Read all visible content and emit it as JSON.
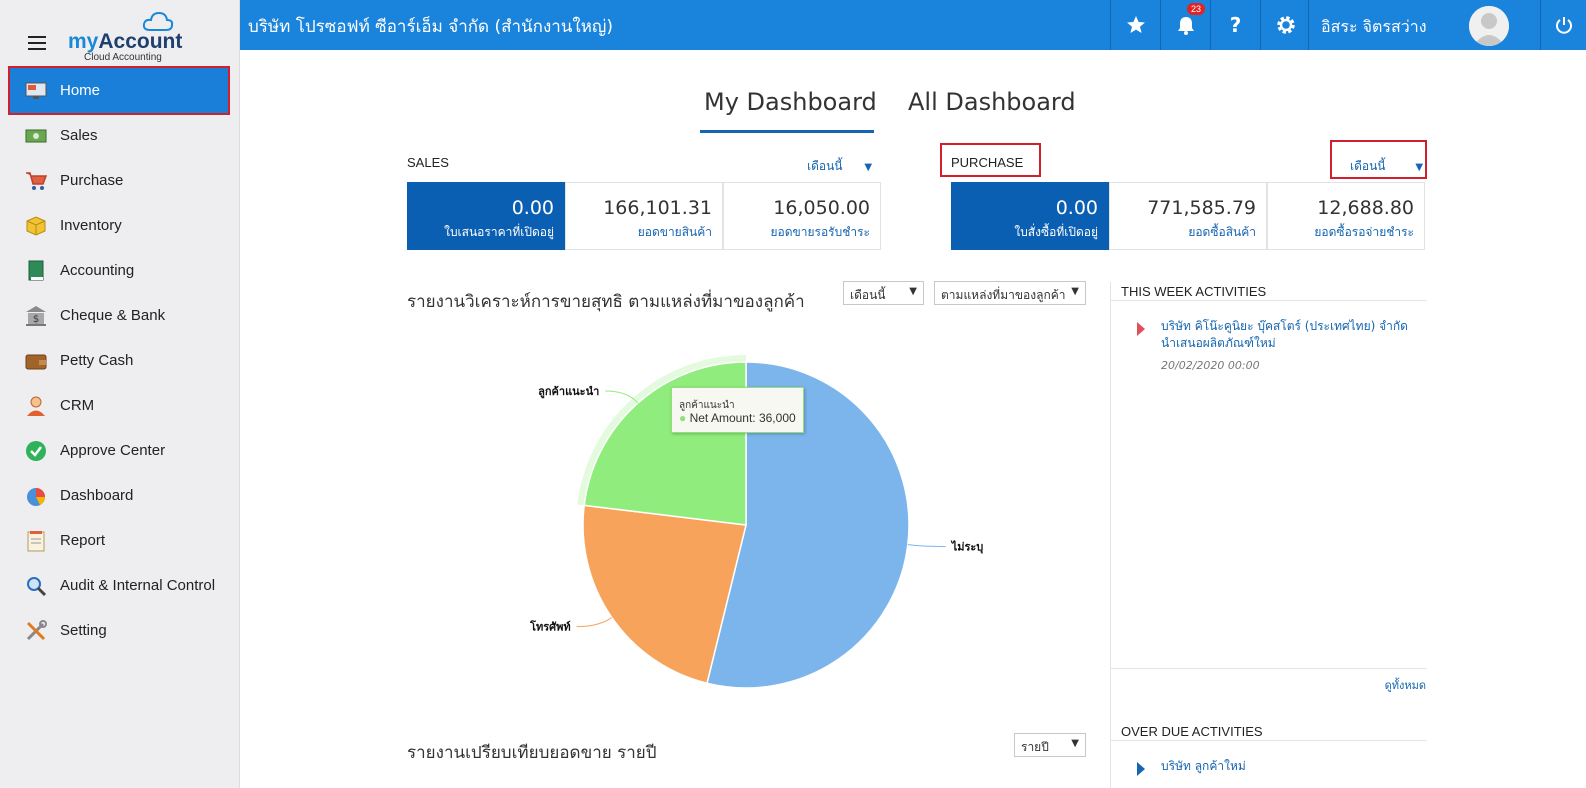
{
  "app": {
    "logo_prefix": "my",
    "logo_main": "Account",
    "logo_sub": "Cloud Accounting"
  },
  "topbar": {
    "company": "บริษัท โปรซอฟท์ ซีอาร์เอ็ม จำกัด (สำนักงานใหญ่)",
    "notification_count": "23",
    "help_label": "?",
    "username": "อิสระ จิตรสว่าง",
    "color": "#1a83dc"
  },
  "sidebar": {
    "items": [
      {
        "label": "Home",
        "icon": "monitor-icon",
        "active": true
      },
      {
        "label": "Sales",
        "icon": "cash-icon"
      },
      {
        "label": "Purchase",
        "icon": "cart-icon"
      },
      {
        "label": "Inventory",
        "icon": "box-icon"
      },
      {
        "label": "Accounting",
        "icon": "book-icon"
      },
      {
        "label": "Cheque & Bank",
        "icon": "bank-icon"
      },
      {
        "label": "Petty Cash",
        "icon": "wallet-icon"
      },
      {
        "label": "CRM",
        "icon": "person-icon"
      },
      {
        "label": "Approve Center",
        "icon": "check-circle-icon"
      },
      {
        "label": "Dashboard",
        "icon": "pie-chart-icon"
      },
      {
        "label": "Report",
        "icon": "report-icon"
      },
      {
        "label": "Audit & Internal Control",
        "icon": "magnifier-icon"
      },
      {
        "label": "Setting",
        "icon": "tools-icon"
      }
    ]
  },
  "tabs": [
    {
      "label": "My Dashboard",
      "active": true
    },
    {
      "label": "All Dashboard"
    }
  ],
  "sales": {
    "title": "SALES",
    "period": "เดือนนี้",
    "stats": [
      {
        "value": "0.00",
        "label": "ใบเสนอราคาที่เปิดอยู่"
      },
      {
        "value": "166,101.31",
        "label": "ยอดขายสินค้า"
      },
      {
        "value": "16,050.00",
        "label": "ยอดขายรอรับชำระ"
      }
    ]
  },
  "purchase": {
    "title": "PURCHASE",
    "period": "เดือนนี้",
    "stats": [
      {
        "value": "0.00",
        "label": "ใบสั่งซื้อที่เปิดอยู่"
      },
      {
        "value": "771,585.79",
        "label": "ยอดซื้อสินค้า"
      },
      {
        "value": "12,688.80",
        "label": "ยอดซื้อรอจ่ายชำระ"
      }
    ]
  },
  "report": {
    "title": "รายงานวิเคราะห์การขายสุทธิ ตามแหล่งที่มาของลูกค้า",
    "period_select": "เดือนนี้",
    "group_select": "ตามแหล่งที่มาของลูกค้า",
    "tooltip_title": "ลูกค้าแนะนำ",
    "tooltip_text": "Net Amount: 36,000"
  },
  "chart_data": {
    "type": "pie",
    "categories": [
      "ไม่ระบุ",
      "โทรศัพท์",
      "ลูกค้าแนะนำ"
    ],
    "values": [
      84000,
      36000,
      36000
    ],
    "colors": [
      "#7cb5ec",
      "#f7a35c",
      "#90ed7d"
    ]
  },
  "report2": {
    "title": "รายงานเปรียบเทียบยอดขาย รายปี",
    "select": "รายปี"
  },
  "activities": {
    "week_title": "THIS WEEK ACTIVITIES",
    "items": [
      {
        "line1": "บริษัท คิโน๊ะคูนิยะ บุ๊คสโตร์ (ประเทศไทย) จำกัด",
        "line2": "นำเสนอผลิตภัณฑ์ใหม่",
        "date": "20/02/2020 00:00"
      }
    ],
    "view_all": "ดูทั้งหมด",
    "overdue_title": "OVER DUE ACTIVITIES",
    "overdue_items": [
      {
        "line1": "บริษัท ลูกค้าใหม่"
      }
    ]
  }
}
